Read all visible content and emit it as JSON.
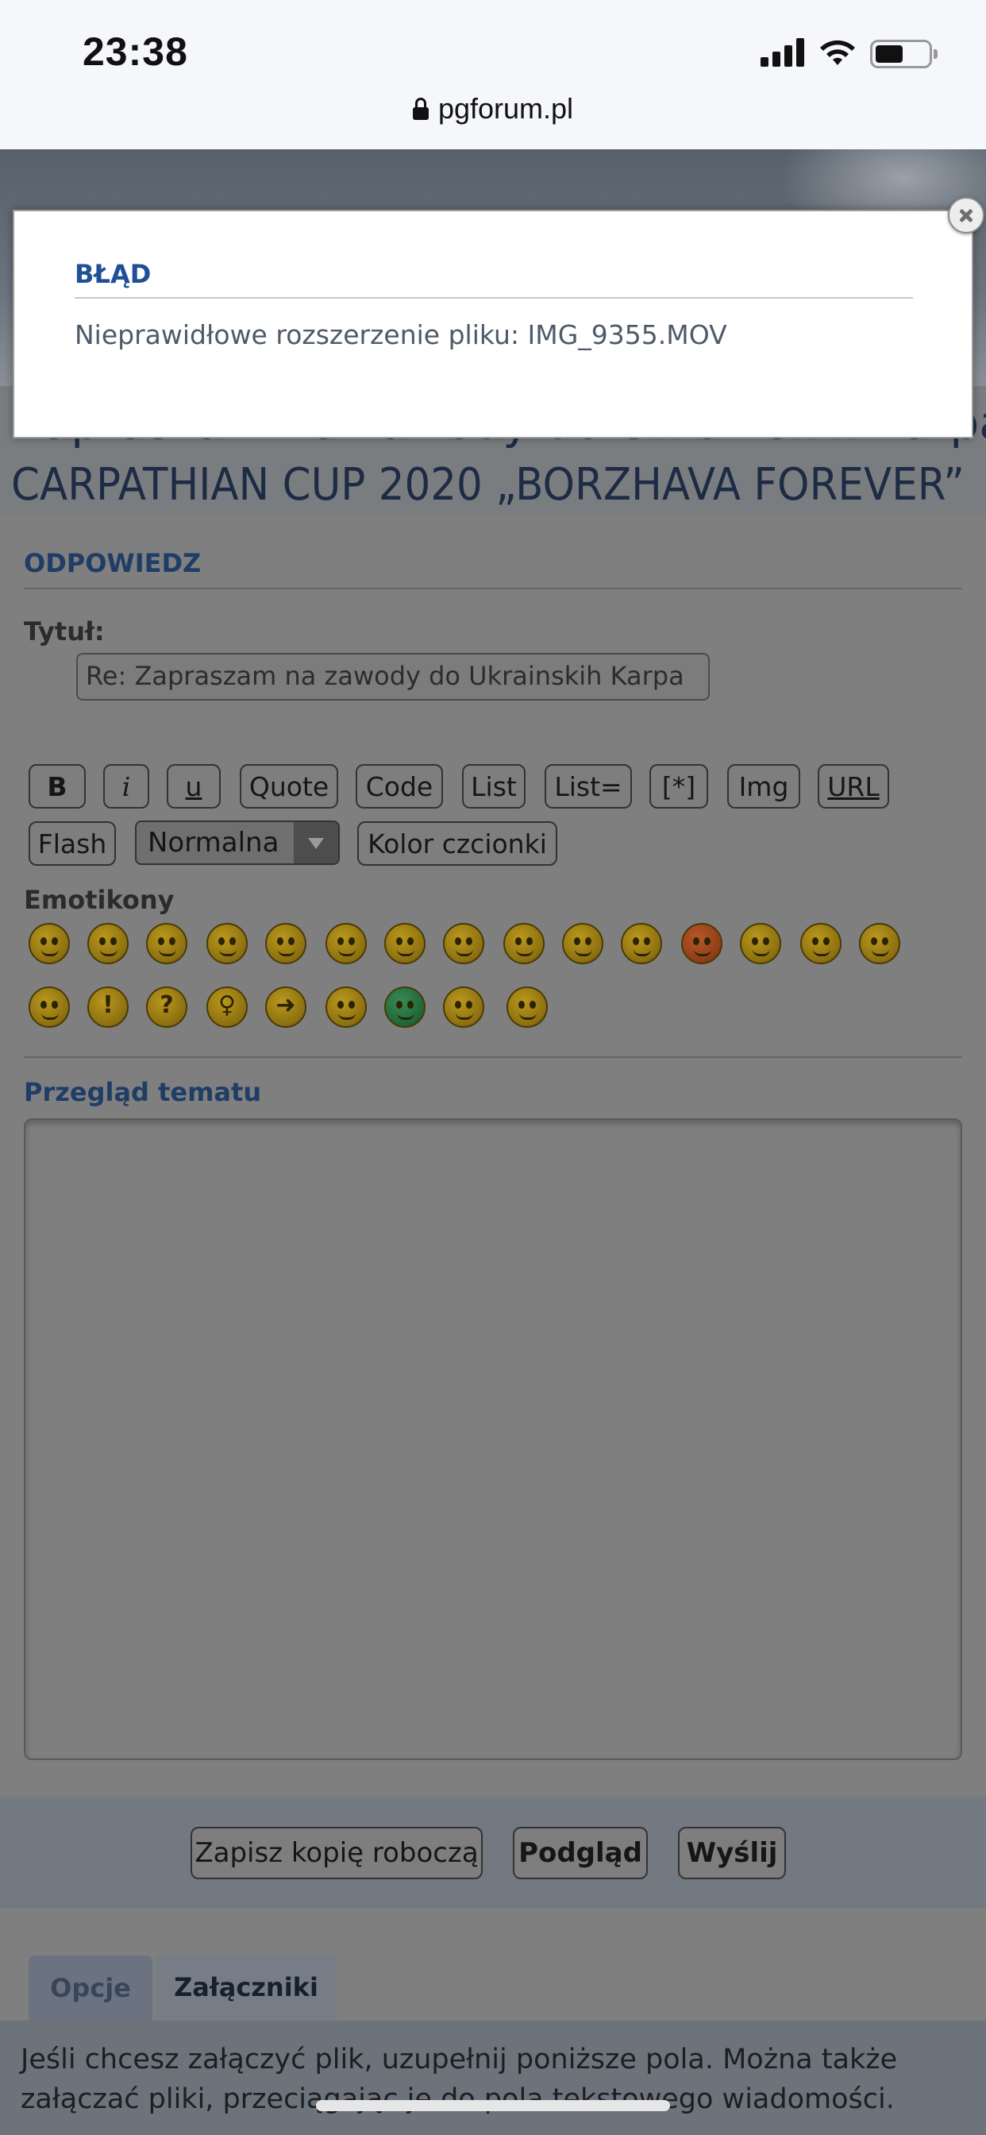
{
  "status_bar": {
    "time": "23:38",
    "url": "pgforum.pl",
    "icons": [
      "signal-icon",
      "wifi-icon",
      "battery-icon",
      "lock-icon"
    ]
  },
  "topic": {
    "title_line1": "Zapraszam na zawody do Ukrainskih Karpat:",
    "title_line2": "CARPATHIAN CUP 2020 „BORZHAVA FOREVER”"
  },
  "reply": {
    "heading": "ODPOWIEDZ",
    "subject_label": "Tytuł:",
    "subject_value": "Re: Zapraszam na zawody do Ukrainskih Karpa",
    "toolbar": {
      "bold": "B",
      "italic": "i",
      "underline": "u",
      "quote": "Quote",
      "code": "Code",
      "list": "List",
      "list_eq": "List=",
      "list_item": "[*]",
      "img": "Img",
      "url": "URL",
      "flash": "Flash",
      "font_size": "Normalna",
      "font_color": "Kolor czcionki"
    },
    "emoticons_label": "Emotikony",
    "emoticons": [
      "very-happy",
      "smile",
      "wink",
      "sad",
      "surprised",
      "shocked",
      "confused",
      "cool",
      "laughing",
      "mad",
      "razz",
      "embarrassed",
      "crying",
      "evil",
      "twisted-evil",
      "rolling-eyes",
      "exclamation",
      "question",
      "idea",
      "arrow",
      "neutral",
      "green-grin",
      "geek",
      "ugeek"
    ],
    "preview_heading": "Przegląd tematu",
    "message_value": ""
  },
  "actions": {
    "save_draft": "Zapisz kopię roboczą",
    "preview": "Podgląd",
    "submit": "Wyślij"
  },
  "tabs": {
    "options": "Opcje",
    "attachments": "Załączniki"
  },
  "attachments": {
    "help_text": "Jeśli chcesz załączyć plik, uzupełnij poniższe pola. Można także załączać pliki, przeciągając je do pola tekstowego wiadomości."
  },
  "modal": {
    "title": "BŁĄD",
    "message": "Nieprawidłowe rozszerzenie pliku: IMG_9355.MOV"
  },
  "colors": {
    "accent_blue": "#1f4f96",
    "heading_blue": "#1f3d66",
    "overlay_gray": "#7f7f7f"
  }
}
